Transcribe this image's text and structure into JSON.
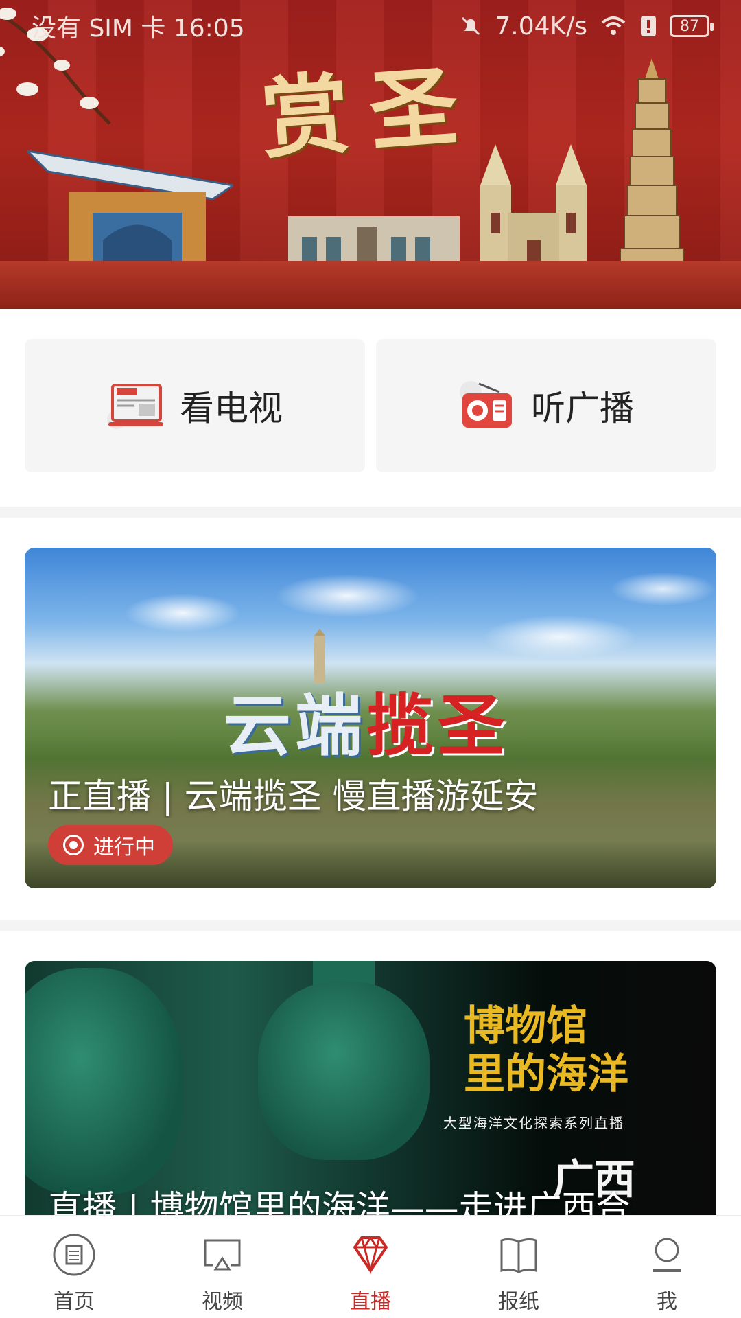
{
  "status_bar": {
    "carrier_time": "没有 SIM 卡 16:05",
    "net_speed": "7.04K/s",
    "battery": "87"
  },
  "banner": {
    "title": "赏圣"
  },
  "quick_actions": [
    {
      "label": "看电视",
      "icon": "tv-news-icon"
    },
    {
      "label": "听广播",
      "icon": "radio-icon"
    }
  ],
  "live_items": [
    {
      "title": "正直播 | 云端揽圣 慢直播游延安",
      "logo_left": "云端",
      "logo_right": "揽圣",
      "status": "进行中"
    },
    {
      "title": "直播 | 博物馆里的海洋——走进广西合…",
      "poster_title": "博物馆\n里的海洋",
      "poster_subtitle": "大型海洋文化探索系列直播",
      "poster_region": "广西"
    }
  ],
  "bottom_nav": [
    {
      "label": "首页",
      "icon": "home-icon",
      "active": false
    },
    {
      "label": "视频",
      "icon": "video-icon",
      "active": false
    },
    {
      "label": "直播",
      "icon": "live-diamond-icon",
      "active": true
    },
    {
      "label": "报纸",
      "icon": "newspaper-icon",
      "active": false
    },
    {
      "label": "我",
      "icon": "profile-icon",
      "active": false
    }
  ],
  "colors": {
    "accent": "#c92a25",
    "banner_red": "#a3201d",
    "tile_bg": "#f5f5f5",
    "badge": "#cf3f38"
  }
}
